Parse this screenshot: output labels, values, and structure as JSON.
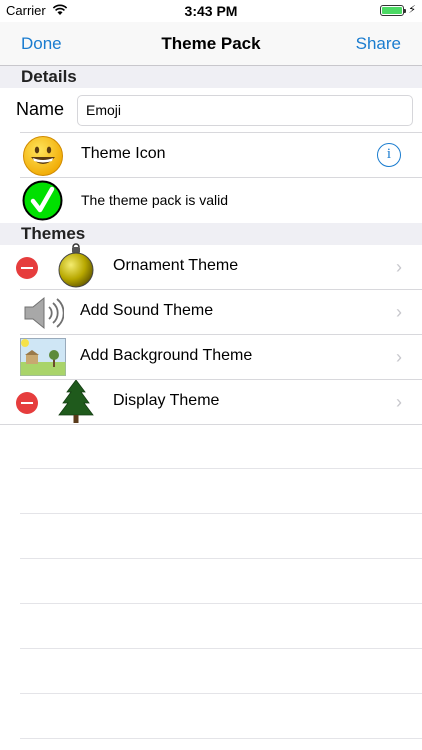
{
  "status_bar": {
    "carrier": "Carrier",
    "time": "3:43 PM"
  },
  "nav": {
    "left_button": "Done",
    "title": "Theme Pack",
    "right_button": "Share"
  },
  "details": {
    "header": "Details",
    "name_label": "Name",
    "name_value": "Emoji",
    "theme_icon_label": "Theme Icon",
    "validity_text": "The theme pack is valid"
  },
  "themes": {
    "header": "Themes",
    "items": [
      {
        "label": "Ornament Theme",
        "icon": "ornament-icon",
        "deletable": true
      },
      {
        "label": "Add Sound Theme",
        "icon": "speaker-icon",
        "deletable": false
      },
      {
        "label": "Add Background Theme",
        "icon": "landscape-image-icon",
        "deletable": false
      },
      {
        "label": "Display Theme",
        "icon": "tree-icon",
        "deletable": true
      }
    ]
  },
  "colors": {
    "accent": "#1a7ccf",
    "delete": "#e63d3d",
    "valid": "#00e000",
    "battery": "#4cd964"
  }
}
